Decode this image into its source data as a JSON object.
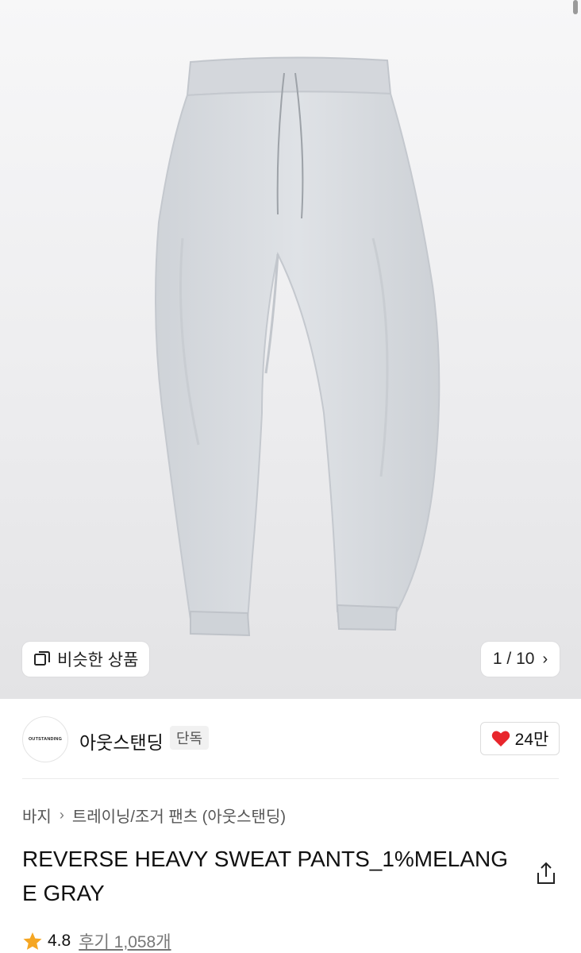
{
  "similar_button": {
    "label": "비슷한 상품",
    "icon": "similar-items-icon"
  },
  "pager": {
    "current": "1",
    "separator": " / ",
    "total": "10"
  },
  "brand": {
    "logo_text": "OUTSTANDING",
    "name": "아웃스탠딩",
    "badge": "단독"
  },
  "like": {
    "count": "24만",
    "color": "#e8262c"
  },
  "breadcrumb": {
    "items": [
      "바지",
      "트레이닝/조거 팬츠 (아웃스탠딩)"
    ]
  },
  "product": {
    "title": "REVERSE HEAVY SWEAT PANTS_1%MELANGE GRAY"
  },
  "rating": {
    "score": "4.8",
    "reviews": "후기 1,058개",
    "star_color": "#f5a623"
  }
}
